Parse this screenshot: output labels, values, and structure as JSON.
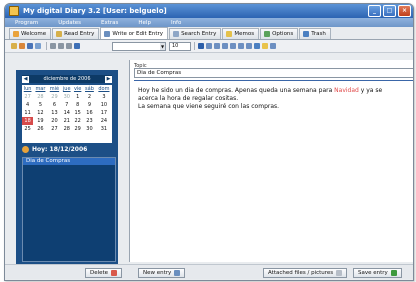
{
  "window": {
    "title": "My digital Diary 3.2   [User: belguelo]"
  },
  "menu": [
    "Program",
    "Updates",
    "Extras",
    "Help",
    "Info"
  ],
  "tabs": [
    {
      "label": "Welcome",
      "color": "#e9a23b"
    },
    {
      "label": "Read Entry",
      "color": "#d6b04a"
    },
    {
      "label": "Write or Edit Entry",
      "color": "#6a8fbf"
    },
    {
      "label": "Search Entry",
      "color": "#8ea6c6"
    },
    {
      "label": "Memos",
      "color": "#e4c14a"
    },
    {
      "label": "Options",
      "color": "#5aa25a"
    },
    {
      "label": "Trash",
      "color": "#4a7fc1"
    }
  ],
  "toolbar": {
    "font_size": "10"
  },
  "calendar": {
    "month": "diciembre de 2006",
    "weekdays": [
      "lun",
      "mar",
      "mié",
      "jue",
      "vie",
      "sáb",
      "dom"
    ],
    "weeks": [
      [
        "27",
        "28",
        "29",
        "30",
        "1",
        "2",
        "3"
      ],
      [
        "4",
        "5",
        "6",
        "7",
        "8",
        "9",
        "10"
      ],
      [
        "11",
        "12",
        "13",
        "14",
        "15",
        "16",
        "17"
      ],
      [
        "18",
        "19",
        "20",
        "21",
        "22",
        "23",
        "24"
      ],
      [
        "25",
        "26",
        "27",
        "28",
        "29",
        "30",
        "31"
      ]
    ],
    "selected": "18"
  },
  "today": "Hoy: 18/12/2006",
  "entries": [
    "Dia de Compras"
  ],
  "topic": {
    "label": "Topic",
    "value": "Dia de Compras"
  },
  "editor": {
    "line1_before": "Hoy he sido un dia de compras. Apenas queda una semana para ",
    "line1_highlight": "Navidad",
    "line1_after": " y ya se",
    "line2": "acerca la hora de regalar cositas.",
    "line3": "La semana que viene seguiré con las compras."
  },
  "buttons": {
    "delete": "Delete",
    "new_entry": "New entry",
    "attached": "Attached files / pictures",
    "save": "Save entry"
  }
}
